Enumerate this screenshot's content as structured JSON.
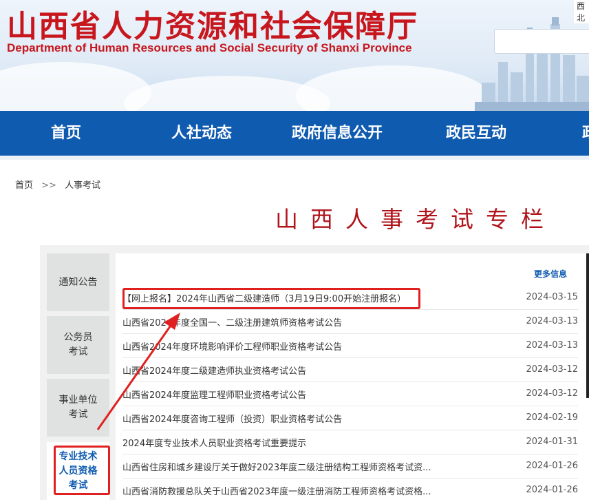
{
  "header": {
    "title_cn": "山西省人力资源和社会保障厅",
    "title_en": "Department of Human Resources and Social Security of Shanxi Province",
    "topbar_text": "西北"
  },
  "nav": {
    "items": [
      {
        "label": "首页"
      },
      {
        "label": "人社动态"
      },
      {
        "label": "政府信息公开"
      },
      {
        "label": "政民互动"
      },
      {
        "label": "政"
      }
    ]
  },
  "breadcrumb": {
    "home": "首页",
    "sep": ">>",
    "current": "人事考试"
  },
  "section_title": "山西人事考试专栏",
  "sidebar": {
    "items": [
      {
        "label": "通知公告"
      },
      {
        "label": "公务员\n考试"
      },
      {
        "label": "事业单位\n考试"
      },
      {
        "label": "专业技术\n人员资格\n考试"
      }
    ]
  },
  "list": {
    "more_label": "更多信息",
    "rows": [
      {
        "title": "【网上报名】2024年山西省二级建造师（3月19日9:00开始注册报名）",
        "date": "2024-03-15"
      },
      {
        "title": "山西省2024年度全国一、二级注册建筑师资格考试公告",
        "date": "2024-03-13"
      },
      {
        "title": "山西省2024年度环境影响评价工程师职业资格考试公告",
        "date": "2024-03-13"
      },
      {
        "title": "山西省2024年度二级建造师执业资格考试公告",
        "date": "2024-03-12"
      },
      {
        "title": "山西省2024年度监理工程师职业资格考试公告",
        "date": "2024-03-12"
      },
      {
        "title": "山西省2024年度咨询工程师（投资）职业资格考试公告",
        "date": "2024-02-19"
      },
      {
        "title": "2024年度专业技术人员职业资格考试重要提示",
        "date": "2024-01-31"
      },
      {
        "title": "山西省住房和城乡建设厅关于做好2023年度二级注册结构工程师资格考试资...",
        "date": "2024-01-26"
      },
      {
        "title": "山西省消防救援总队关于山西省2023年度一级注册消防工程师资格考试资格...",
        "date": "2024-01-26"
      }
    ]
  },
  "colors": {
    "brand_red": "#c8161d",
    "nav_blue": "#0f5bb0",
    "annotation_red": "#e02020"
  }
}
